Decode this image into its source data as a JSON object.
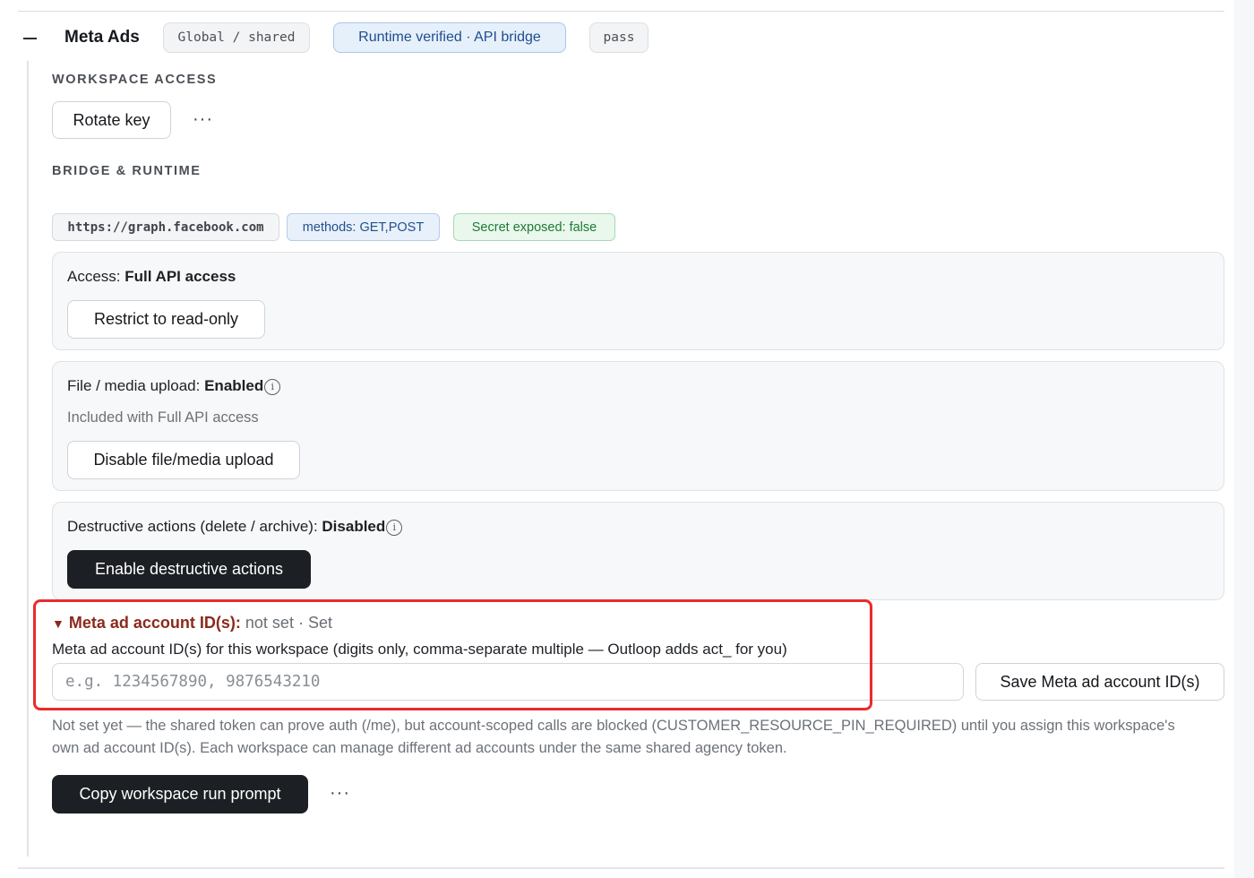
{
  "header": {
    "title": "Meta Ads",
    "scope_chip": "Global / shared",
    "status_chip": "Runtime verified · API bridge",
    "result_chip": "pass"
  },
  "workspace_access": {
    "section_label": "WORKSPACE ACCESS",
    "rotate_label": "Rotate key",
    "more_label": "···"
  },
  "bridge_runtime": {
    "section_label": "BRIDGE & RUNTIME",
    "url": "https://graph.facebook.com",
    "methods": "methods: GET,POST",
    "secret": "Secret exposed: false"
  },
  "access_card": {
    "prefix": "Access: ",
    "value": "Full API access",
    "button": "Restrict to read-only"
  },
  "upload_card": {
    "prefix": "File / media upload: ",
    "value": "Enabled",
    "info_glyph": "i",
    "note": "Included with Full API access",
    "button": "Disable file/media upload"
  },
  "destructive_card": {
    "prefix": "Destructive actions (delete / archive): ",
    "value": "Disabled",
    "info_glyph": "i",
    "button": "Enable destructive actions"
  },
  "ad_account": {
    "caret": "▼",
    "label": "Meta ad account ID(s):",
    "state": " not set · Set",
    "helper": "Meta ad account ID(s) for this workspace (digits only, comma-separate multiple — Outloop adds act_ for you)",
    "placeholder": "e.g. 1234567890, 9876543210",
    "value": "",
    "save_button": "Save Meta ad account ID(s)",
    "note": "Not set yet — the shared token can prove auth (/me), but account-scoped calls are blocked (CUSTOMER_RESOURCE_PIN_REQUIRED) until you assign this workspace's own ad account ID(s). Each workspace can manage different ad accounts under the same shared agency token."
  },
  "footer": {
    "copy_button": "Copy workspace run prompt",
    "more_label": "···"
  },
  "colors": {
    "highlight": "#ea2b2b",
    "dark_button": "#1c1f23",
    "secret_green": "#1f7a36",
    "summary_red": "#8b2a1c"
  }
}
